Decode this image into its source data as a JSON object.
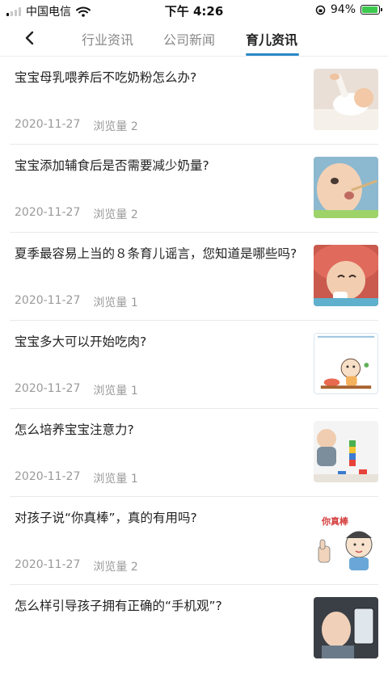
{
  "status_bar": {
    "carrier": "中国电信",
    "time": "下午 4:26",
    "battery": "94%",
    "battery_level": 0.94
  },
  "tabs": [
    {
      "label": "行业资讯"
    },
    {
      "label": "公司新闻"
    },
    {
      "label": "育儿资讯"
    }
  ],
  "active_tab": 2,
  "articles": [
    {
      "title": "宝宝母乳喂养后不吃奶粉怎么办?",
      "date": "2020-11-27",
      "views": "浏览量 2"
    },
    {
      "title": "宝宝添加辅食后是否需要减少奶量?",
      "date": "2020-11-27",
      "views": "浏览量 2"
    },
    {
      "title": "夏季最容易上当的８条育儿谣言，您知道是哪些吗?",
      "date": "2020-11-27",
      "views": "浏览量 1"
    },
    {
      "title": "宝宝多大可以开始吃肉?",
      "date": "2020-11-27",
      "views": "浏览量 1"
    },
    {
      "title": "怎么培养宝宝注意力?",
      "date": "2020-11-27",
      "views": "浏览量 1"
    },
    {
      "title": "对孩子说“你真棒”，真的有用吗?",
      "date": "2020-11-27",
      "views": "浏览量 2",
      "thumb_text": "你真棒"
    },
    {
      "title": "怎么样引导孩子拥有正确的“手机观”?",
      "date": "",
      "views": ""
    }
  ]
}
